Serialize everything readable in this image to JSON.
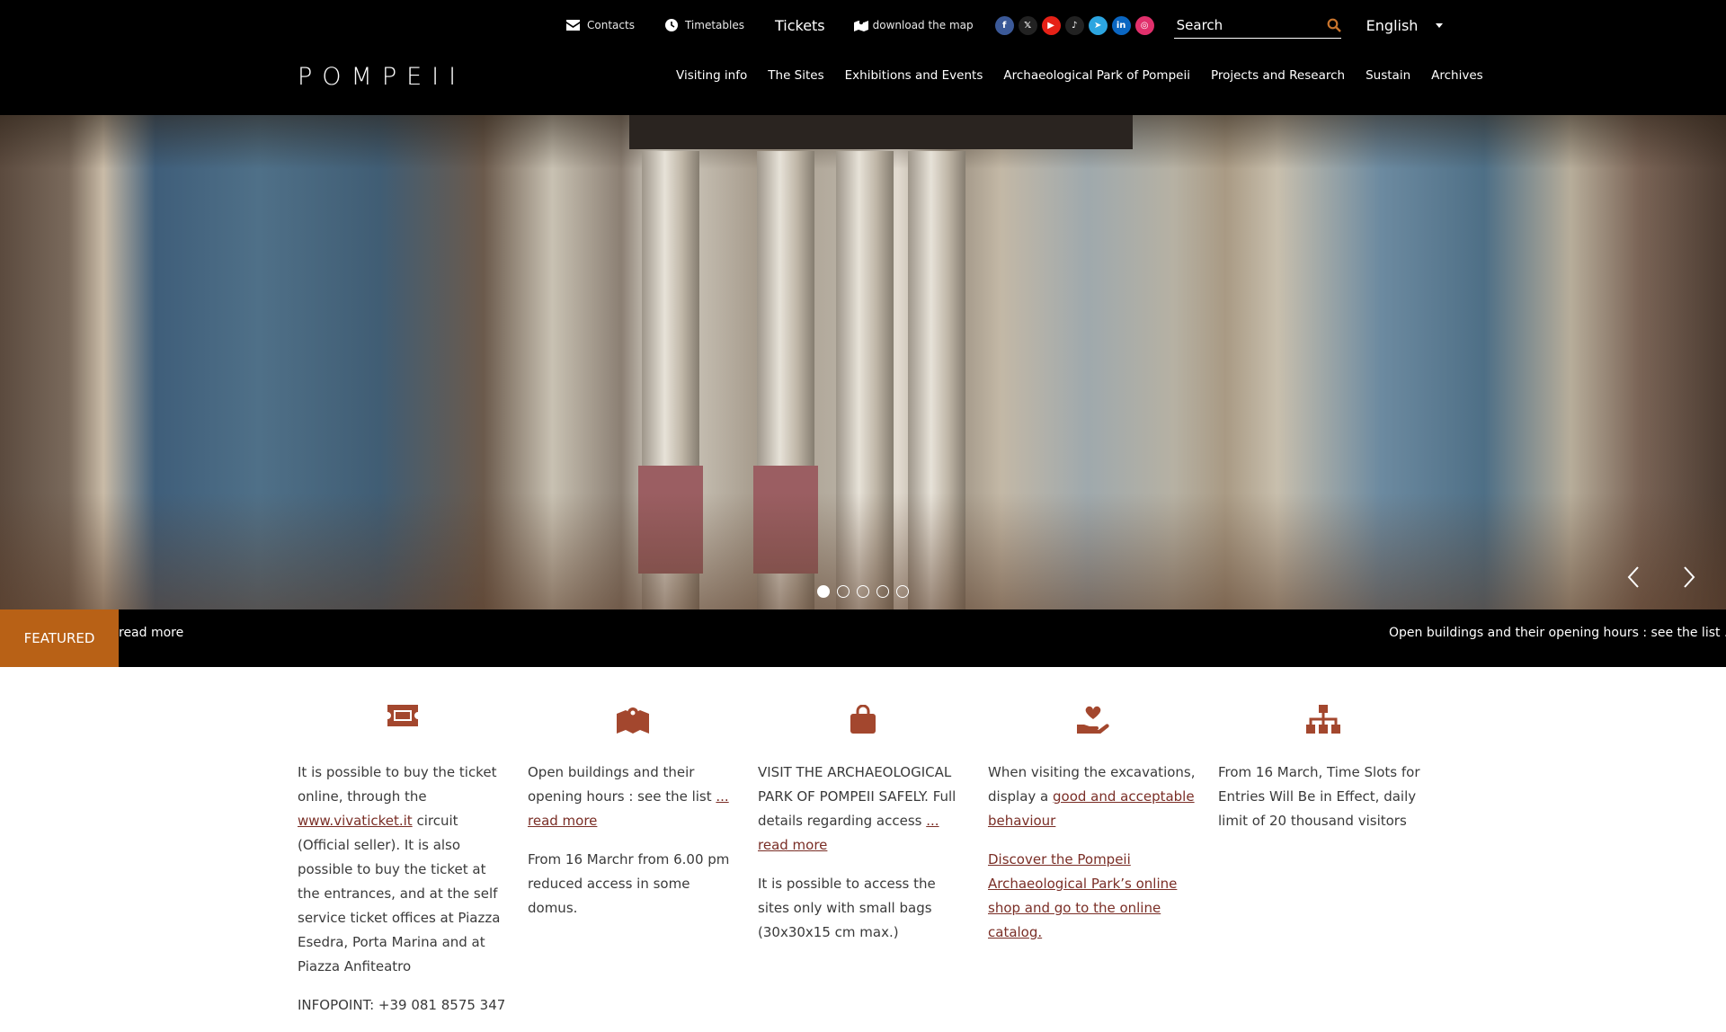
{
  "topbar": {
    "contacts": "Contacts",
    "timetables": "Timetables",
    "tickets": "Tickets",
    "download_map": "download the map",
    "socials": [
      {
        "name": "facebook",
        "glyph": "f",
        "color": "#3b5998"
      },
      {
        "name": "x",
        "glyph": "𝕏",
        "color": "#222222"
      },
      {
        "name": "youtube",
        "glyph": "▶",
        "color": "#e62117"
      },
      {
        "name": "tiktok",
        "glyph": "♪",
        "color": "#222222"
      },
      {
        "name": "telegram",
        "glyph": "➤",
        "color": "#2ca5e0"
      },
      {
        "name": "linkedin",
        "glyph": "in",
        "color": "#0a66c2"
      },
      {
        "name": "instagram",
        "glyph": "◎",
        "color": "#e1306c"
      }
    ],
    "search_placeholder": "Search",
    "language": "English"
  },
  "logo": {
    "text": "POMPEII"
  },
  "nav": [
    "Visiting info",
    "The Sites",
    "Exhibitions and Events",
    "Archaeological Park of Pompeii",
    "Projects and Research",
    "Sustain",
    "Archives"
  ],
  "slider": {
    "slide_count": 5,
    "active_index": 0
  },
  "ticker": {
    "featured_label": "FEATURED",
    "left_text": "read more",
    "right_text": "Open buildings and their opening hours : see the list ..."
  },
  "cards": [
    {
      "icon": "ticket-icon",
      "p1_pre": "It is possible to buy the ticket online, through the ",
      "p1_link": "www.vivaticket.it",
      "p1_post": " circuit (Official seller).  It is also possible to buy the ticket at the entrances, and at the self service ticket offices at Piazza Esedra, Porta Marina and at Piazza Anfiteatro",
      "p2": "INFOPOINT: +39 081 8575 347"
    },
    {
      "icon": "map-icon",
      "p1_pre": "Open buildings and their opening hours : see the list ",
      "p1_link": "... read more",
      "p2": "From 16 Marchr from 6.00 pm reduced access in some domus."
    },
    {
      "icon": "bag-icon",
      "p1_pre": "VISIT THE ARCHAEOLOGICAL PARK OF POMPEII SAFELY. Full details regarding access ",
      "p1_link": "... read more",
      "p2": "It is possible to access the sites only with small bags (30x30x15 cm max.)"
    },
    {
      "icon": "hand-heart-icon",
      "p1_pre": "When visiting the excavations, display a ",
      "p1_link": "good and acceptable behaviour",
      "p2_link": "Discover the Pompeii Archaeological Park’s online shop and go to the online catalog."
    },
    {
      "icon": "sitemap-icon",
      "p1_pre": "From 16 March, Time Slots for Entries Will Be in Effect, daily limit of 20 thousand visitors"
    }
  ]
}
